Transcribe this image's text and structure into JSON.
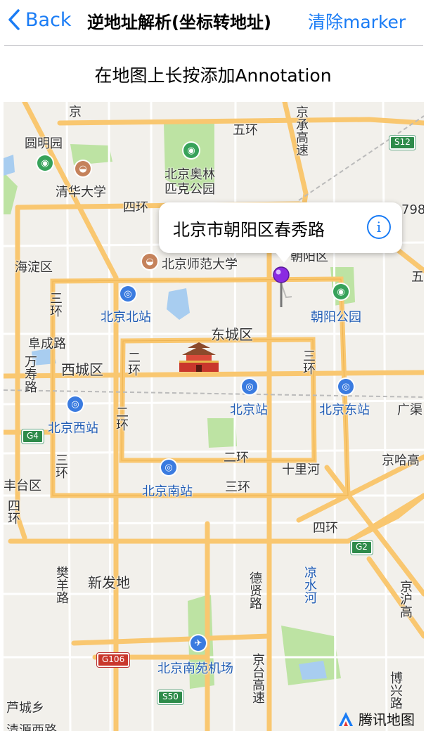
{
  "nav": {
    "back_label": "Back",
    "title": "逆地址解析(坐标转地址)",
    "right_label": "清除marker"
  },
  "hint": "在地图上长按添加Annotation",
  "callout": {
    "address": "北京市朝阳区春秀路",
    "info_glyph": "i"
  },
  "brand": "腾讯地图",
  "map_labels": {
    "yuanmingyuan": "圆明园",
    "tsinghua": "清华大学",
    "olympic": "北京奥林匹克公园",
    "olympic_1": "北京奥林",
    "olympic_2": "匹克公园",
    "wuhuan": "五环",
    "sihuan": "四环",
    "haidian": "海淀区",
    "bnu": "北京师范大学",
    "chaoyang": "朝阳区",
    "chaoyang_park": "朝阳公园",
    "sanhuan_left": "三环",
    "bjnorth": "北京北站",
    "dongcheng": "东城区",
    "fuchenglu": "阜成路",
    "wanshoulu": "万寿路",
    "xicheng": "西城区",
    "erhuan_left": "二环",
    "sanhuan_right": "三环",
    "bj_station": "北京站",
    "bj_east": "北京东站",
    "guangqu": "广渠",
    "bj_west": "北京西站",
    "erhuan_west": "二环",
    "sanhuan_west": "三环",
    "fengtai": "丰台区",
    "erhuan_south": "二环",
    "shilihe": "十里河",
    "jinghagao": "京哈高",
    "bj_south": "北京南站",
    "sanhuan_south": "三环",
    "sihuan_sw": "四环",
    "sihuan_se": "四环",
    "fanyanglu": "樊羊路",
    "xinfadi": "新发地",
    "dexianlu": "德贤路",
    "liangshuihe": "凉水河",
    "jinghugao": "京沪高",
    "nanyuan": "北京南苑机场",
    "jingtaigao": "京台高速",
    "luchengxiang": "芦城乡",
    "qingyuanxilu": "清源西路",
    "boxinglu": "博兴路",
    "jingchenggao": "京承高速",
    "jing_top": "京",
    "zhonghuan_right": "五",
    "s12": "S12",
    "g4": "G4",
    "g2": "G2",
    "g106": "G106",
    "s50": "S50",
    "s798": "798"
  },
  "colors": {
    "accent": "#1a7cf5",
    "road_major": "#f9c770",
    "road_minor": "#ffffff",
    "park": "#bde3a3",
    "water": "#a8cdf0",
    "pin": "#8a2be2"
  }
}
